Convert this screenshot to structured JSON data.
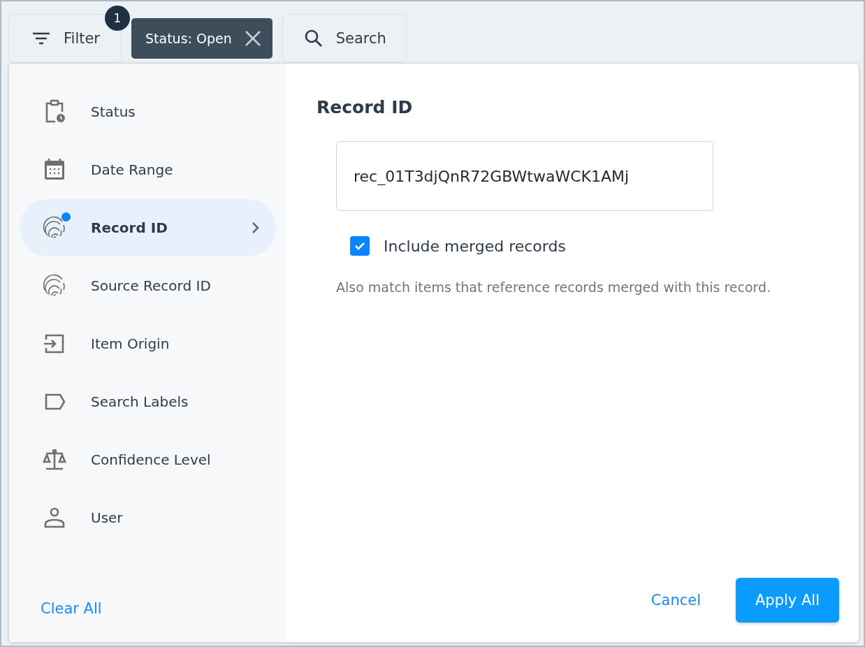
{
  "toolbar": {
    "filter_button": {
      "label": "Filter",
      "badge": "1"
    },
    "chips": [
      {
        "label": "Status: Open"
      }
    ],
    "search_button": {
      "label": "Search"
    }
  },
  "sidebar": {
    "items": [
      {
        "label": "Status",
        "selected": false,
        "has_value": false
      },
      {
        "label": "Date Range",
        "selected": false,
        "has_value": false
      },
      {
        "label": "Record ID",
        "selected": true,
        "has_value": true
      },
      {
        "label": "Source Record ID",
        "selected": false,
        "has_value": false
      },
      {
        "label": "Item Origin",
        "selected": false,
        "has_value": false
      },
      {
        "label": "Search Labels",
        "selected": false,
        "has_value": false
      },
      {
        "label": "Confidence Level",
        "selected": false,
        "has_value": false
      },
      {
        "label": "User",
        "selected": false,
        "has_value": false
      }
    ],
    "clear_all": "Clear All"
  },
  "detail": {
    "title": "Record ID",
    "input": {
      "value": "rec_01T3djQnR72GBWtwaWCK1AMj"
    },
    "checkbox": {
      "label": "Include merged records",
      "checked": true
    },
    "help": "Also match items that reference records merged with this record."
  },
  "footer": {
    "cancel": "Cancel",
    "apply": "Apply All"
  }
}
